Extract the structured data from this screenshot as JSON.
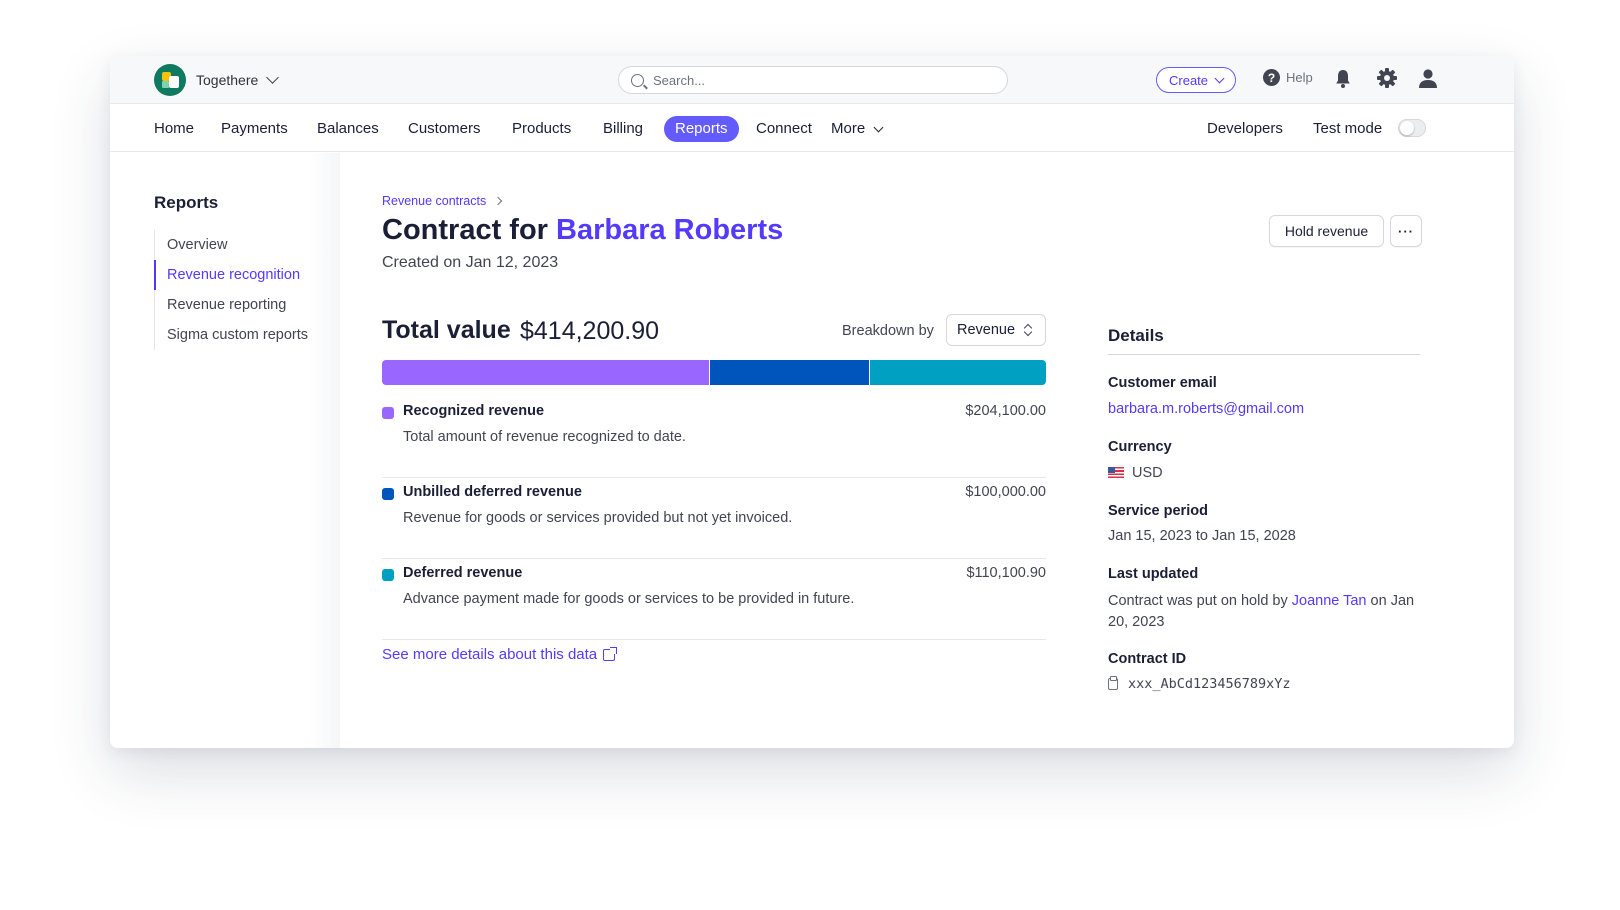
{
  "topbar": {
    "account_name": "Togethere",
    "search_placeholder": "Search...",
    "create_label": "Create",
    "help_label": "Help"
  },
  "nav": {
    "items": [
      "Home",
      "Payments",
      "Balances",
      "Customers",
      "Products",
      "Billing",
      "Reports",
      "Connect"
    ],
    "more_label": "More",
    "active": "Reports",
    "developers_label": "Developers",
    "test_mode_label": "Test mode",
    "test_mode_enabled": false
  },
  "sidebar": {
    "title": "Reports",
    "items": [
      {
        "label": "Overview",
        "active": false
      },
      {
        "label": "Revenue recognition",
        "active": true
      },
      {
        "label": "Revenue reporting",
        "active": false
      },
      {
        "label": "Sigma custom reports",
        "active": false
      }
    ]
  },
  "page": {
    "breadcrumb": "Revenue contracts",
    "title_prefix": "Contract for",
    "customer_name": "Barbara Roberts",
    "created": "Created on Jan 12, 2023",
    "hold_label": "Hold revenue",
    "more_label": "···"
  },
  "summary": {
    "total_label": "Total value",
    "total_value": "$414,200.90",
    "breakdown_label": "Breakdown by",
    "breakdown_selected": "Revenue",
    "rows": [
      {
        "title": "Recognized revenue",
        "amount": "$204,100.00",
        "amount_value": 204100.0,
        "description": "Total amount of revenue recognized to date.",
        "color": "#9966ff"
      },
      {
        "title": "Unbilled deferred revenue",
        "amount": "$100,000.00",
        "amount_value": 100000.0,
        "description": "Revenue for goods or services provided but not yet invoiced.",
        "color": "#0055bc"
      },
      {
        "title": "Deferred revenue",
        "amount": "$110,100.90",
        "amount_value": 110100.9,
        "description": "Advance payment made for goods or services to be provided in future.",
        "color": "#00a0c2"
      }
    ],
    "see_more_label": "See more details about this data"
  },
  "details": {
    "title": "Details",
    "customer_email_label": "Customer email",
    "customer_email": "barbara.m.roberts@gmail.com",
    "currency_label": "Currency",
    "currency": "USD",
    "service_period_label": "Service period",
    "service_period": "Jan 15, 2023 to Jan 15, 2028",
    "last_updated_label": "Last updated",
    "last_updated_prefix": "Contract was put on hold by",
    "last_updated_user": "Joanne Tan",
    "last_updated_suffix": "on Jan 20, 2023",
    "contract_id_label": "Contract ID",
    "contract_id": "xxx_AbCd123456789xYz"
  },
  "colors": {
    "accent": "#635bff",
    "link": "#533afd",
    "brand_logo": "#0e7a5f"
  }
}
